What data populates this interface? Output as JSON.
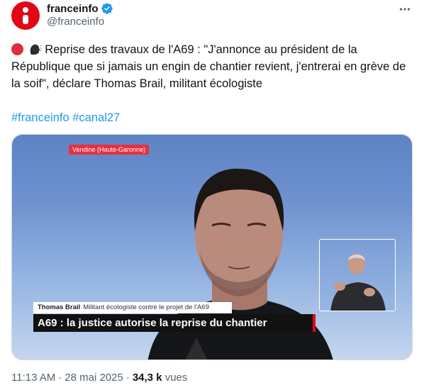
{
  "author": {
    "display_name": "franceinfo",
    "handle": "@franceinfo",
    "avatar_icon": "franceinfo-logo-icon",
    "verified_icon": "verified-badge-icon"
  },
  "more_icon": "more-options-icon",
  "tweet": {
    "emojis": [
      "red-circle-emoji",
      "speaking-head-emoji"
    ],
    "text": "Reprise des travaux de l'A69 : \"J'annonce au président de la République que si jamais un engin de chantier revient, j'entrerai en grève de la soif\", déclare Thomas Brail, militant écologiste",
    "hashtags": [
      "#franceinfo",
      "#canal27"
    ]
  },
  "video": {
    "location_tag": "Vendine (Haute-Garonne)",
    "caption_name": "Thomas Brail",
    "caption_role": "Militant écologiste contre le projet de l'A69",
    "headline": "A69 : la justice autorise la reprise du chantier"
  },
  "meta": {
    "time": "11:13 AM",
    "separator": "·",
    "date": "28 mai 2025",
    "views_count": "34,3 k",
    "views_label": "vues"
  },
  "colors": {
    "brand_red": "#e30613",
    "link_blue": "#1d9bf0",
    "verified_blue": "#1d9bf0",
    "text": "#0f1419",
    "secondary_text": "#536471"
  }
}
